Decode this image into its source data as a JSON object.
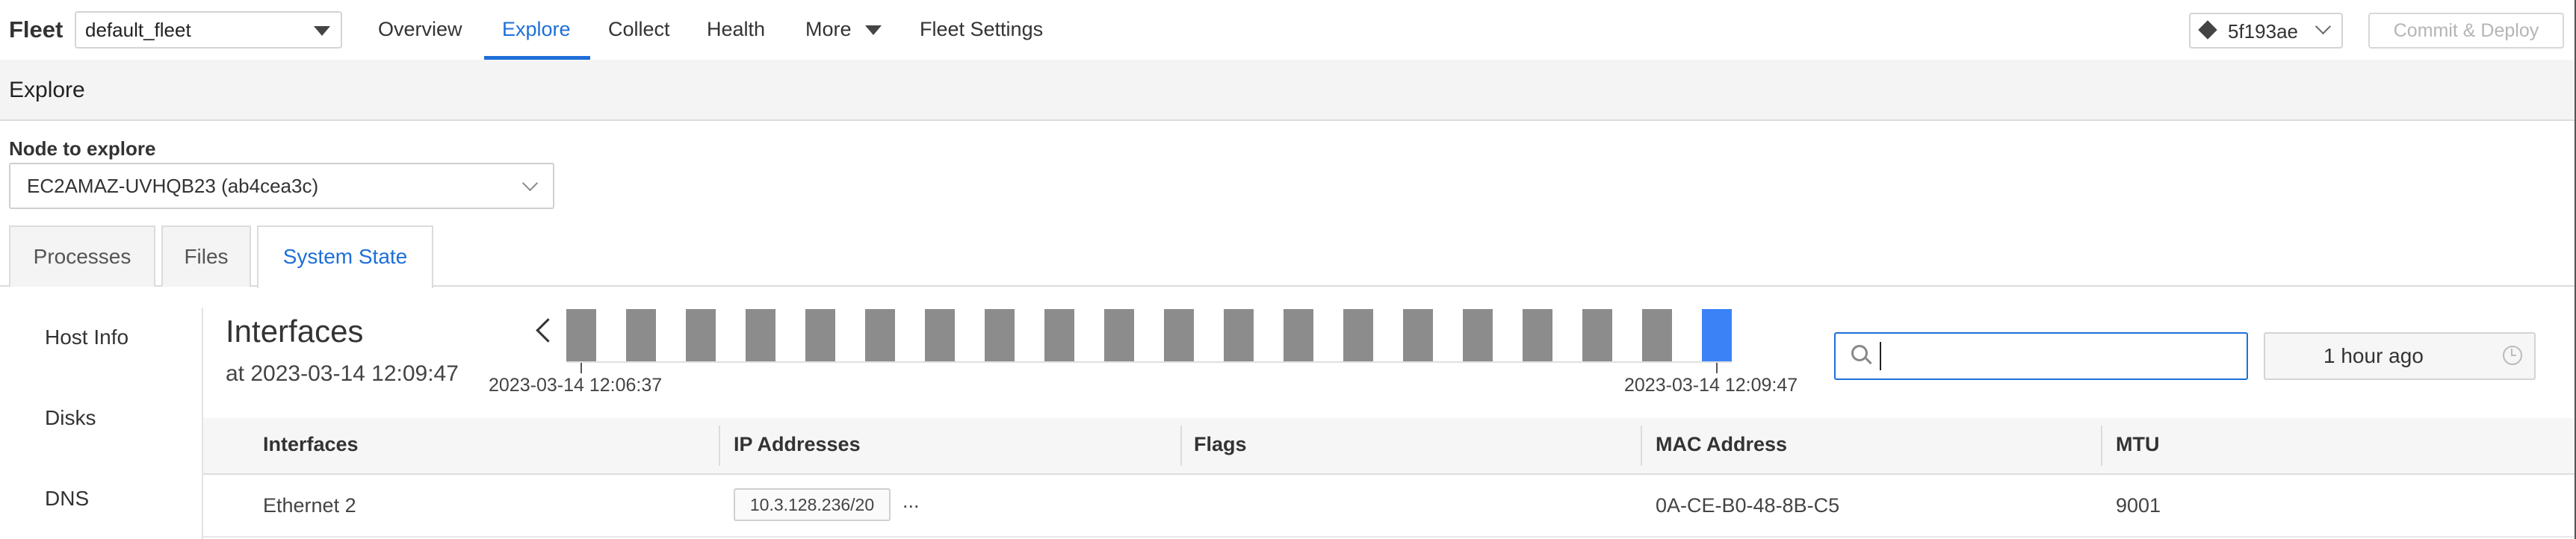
{
  "header": {
    "fleet_label": "Fleet",
    "fleet_select_value": "default_fleet",
    "nav": [
      "Overview",
      "Explore",
      "Collect",
      "Health",
      "More",
      "Fleet Settings"
    ],
    "active_nav": "Explore",
    "branch_value": "5f193ae",
    "commit_label": "Commit & Deploy"
  },
  "page": {
    "section_title": "Explore",
    "node_label": "Node to explore",
    "node_value": "EC2AMAZ-UVHQB23 (ab4cea3c)",
    "tabs": [
      "Processes",
      "Files",
      "System State"
    ],
    "active_tab": "System State"
  },
  "sidebar": {
    "items": [
      "Host Info",
      "Disks",
      "DNS"
    ]
  },
  "interfaces": {
    "title": "Interfaces",
    "subtitle": "at 2023-03-14 12:09:47",
    "timeline": {
      "start_label": "2023-03-14 12:06:37",
      "end_label": "2023-03-14 12:09:47",
      "snapshot_count": 20,
      "selected_index": 19
    },
    "search": {
      "value": "",
      "placeholder": ""
    },
    "time_range": "1 hour ago",
    "table": {
      "headers": [
        "Interfaces",
        "IP Addresses",
        "Flags",
        "MAC Address",
        "MTU"
      ],
      "rows": [
        {
          "interface": "Ethernet 2",
          "ip": "10.3.128.236/20",
          "ip_more": "...",
          "flags": "",
          "mac": "0A-CE-B0-48-8B-C5",
          "mtu": "9001"
        }
      ]
    }
  },
  "colors": {
    "accent": "#1e6fd9",
    "timeline_bar": "#8c8c8c",
    "timeline_selected": "#3b82f6"
  }
}
